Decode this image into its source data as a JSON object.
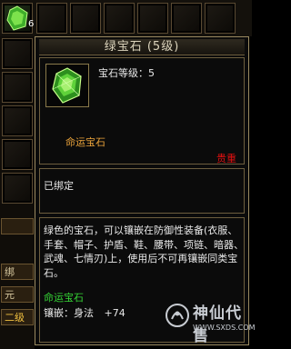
{
  "inventory": {
    "first_slot_count": "6"
  },
  "side": {
    "label_1": "绑",
    "label_2": "元",
    "label_3": "二级"
  },
  "tooltip": {
    "title": "绿宝石 (5级)",
    "gem_icon": "green-gem-icon",
    "level_line": "宝石等级：5",
    "fate_label": "命运宝石",
    "rarity": "贵重",
    "bound_status": "已绑定",
    "description": "绿色的宝石，可以镶嵌在防御性装备(衣服、手套、帽子、护盾、鞋、腰带、项链、暗器、武魂、七情刃)上，使用后不可再镶嵌同类宝石。",
    "fate_green": "命运宝石",
    "inlay_label": "镶嵌：身法",
    "inlay_value": "+74"
  },
  "watermark": {
    "brand": "神仙代售",
    "url": "WWW.SXDS.COM"
  },
  "colors": {
    "panel_border": "#9a8a60",
    "fate_orange": "#e8a23a",
    "rarity_red": "#e01010",
    "green_text": "#35d435"
  }
}
